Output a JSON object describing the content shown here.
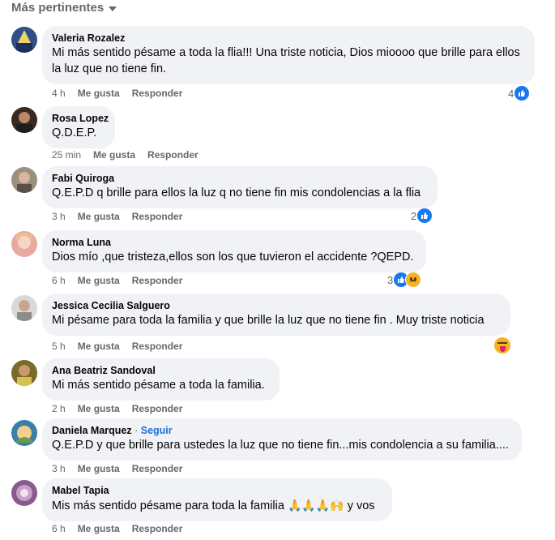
{
  "sort_label": "Más pertinentes",
  "action_like": "Me gusta",
  "action_reply": "Responder",
  "comments": [
    {
      "name": "Valeria Rozalez",
      "follow": "",
      "text": "Mi más sentido pésame a toda la flia!!! Una triste noticia, Dios mioooo que brille para ellos la luz que no tiene fin.",
      "time": "4 h",
      "reactions": "4"
    },
    {
      "name": "Rosa Lopez",
      "follow": "",
      "text": "Q.D.E.P.",
      "time": "25 min",
      "reactions": ""
    },
    {
      "name": "Fabi Quiroga",
      "follow": "",
      "text": "Q.E.P.D q brille para ellos la luz q no tiene fin mis condolencias a la flia",
      "time": "3 h",
      "reactions": "2"
    },
    {
      "name": "Norma Luna",
      "follow": "",
      "text": "Dios mío ,que tristeza,ellos son los que tuvieron el accidente ?QEPD.",
      "time": "6 h",
      "reactions": "3"
    },
    {
      "name": "Jessica Cecilia Salguero",
      "follow": "",
      "text": "Mi pésame para toda la familia y que brille la luz que no tiene fin . Muy triste noticia",
      "time": "5 h",
      "reactions": ""
    },
    {
      "name": "Ana Beatriz Sandoval",
      "follow": "",
      "text": "Mi más sentido pésame a toda la familia.",
      "time": "2 h",
      "reactions": ""
    },
    {
      "name": "Daniela Marquez",
      "follow": "Seguir",
      "text": "Q.E.P.D y que brille para ustedes la luz que no tiene fin...mis condolencia a su familia....",
      "time": "3 h",
      "reactions": ""
    },
    {
      "name": "Mabel Tapia",
      "follow": "",
      "text": "Mis más sentido pésame para toda la familia",
      "emoji": "🙏🙏🙏🙌",
      "text_tail": "y vos",
      "time": "6 h",
      "reactions": ""
    }
  ],
  "colors": {
    "bubble": "#f0f2f5",
    "meta": "#65676b",
    "link": "#216fdb",
    "like": "#1877f2"
  }
}
